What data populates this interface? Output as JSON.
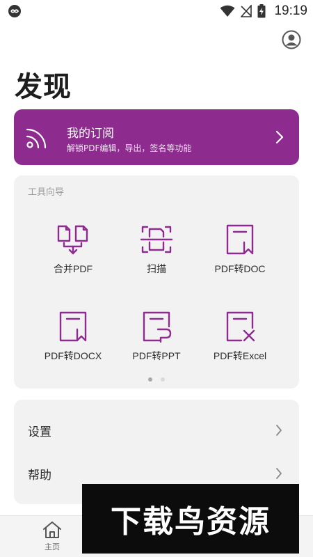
{
  "status_bar": {
    "time": "19:19"
  },
  "page": {
    "title": "发现"
  },
  "subscription": {
    "title": "我的订阅",
    "subtitle": "解锁PDF编辑，导出，签名等功能",
    "accent": "#8e2b8f"
  },
  "tools": {
    "header": "工具向导",
    "items": [
      {
        "label": "合并PDF",
        "icon": "merge-pdf-icon"
      },
      {
        "label": "扫描",
        "icon": "scan-icon"
      },
      {
        "label": "PDF转DOC",
        "icon": "pdf-to-doc-icon"
      },
      {
        "label": "PDF转DOCX",
        "icon": "pdf-to-docx-icon"
      },
      {
        "label": "PDF转PPT",
        "icon": "pdf-to-ppt-icon"
      },
      {
        "label": "PDF转Excel",
        "icon": "pdf-to-excel-icon"
      }
    ],
    "pages": 2,
    "current_page": 1
  },
  "settings": {
    "items": [
      {
        "label": "设置"
      },
      {
        "label": "帮助"
      }
    ]
  },
  "bottom_nav": {
    "items": [
      {
        "label": "主页",
        "icon": "home-icon"
      }
    ]
  },
  "watermark": {
    "text": "下载鸟资源"
  },
  "colors": {
    "accent": "#8e2b8f",
    "card": "#f2f2f2"
  }
}
